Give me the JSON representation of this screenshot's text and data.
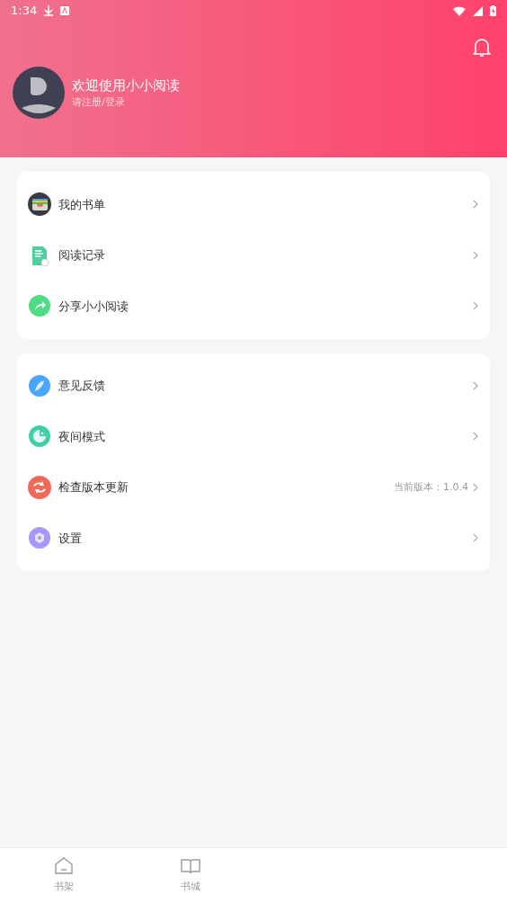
{
  "status_bar": {
    "time": "1:34"
  },
  "profile": {
    "title": "欢迎使用小小阅读",
    "subtitle": "请注册/登录"
  },
  "menu_groups": [
    {
      "items": [
        {
          "kind": "booklist",
          "label": "我的书单"
        },
        {
          "kind": "history",
          "label": "阅读记录"
        },
        {
          "kind": "share",
          "label": "分享小小阅读"
        }
      ]
    },
    {
      "items": [
        {
          "kind": "feedback",
          "label": "意见反馈"
        },
        {
          "kind": "night",
          "label": "夜间模式"
        },
        {
          "kind": "update",
          "label": "检查版本更新",
          "value": "当前版本：1.0.4"
        },
        {
          "kind": "settings",
          "label": "设置"
        }
      ]
    }
  ],
  "bottom_nav": [
    {
      "kind": "shelf",
      "label": "书架",
      "selected": false
    },
    {
      "kind": "store",
      "label": "书城",
      "selected": false
    }
  ]
}
